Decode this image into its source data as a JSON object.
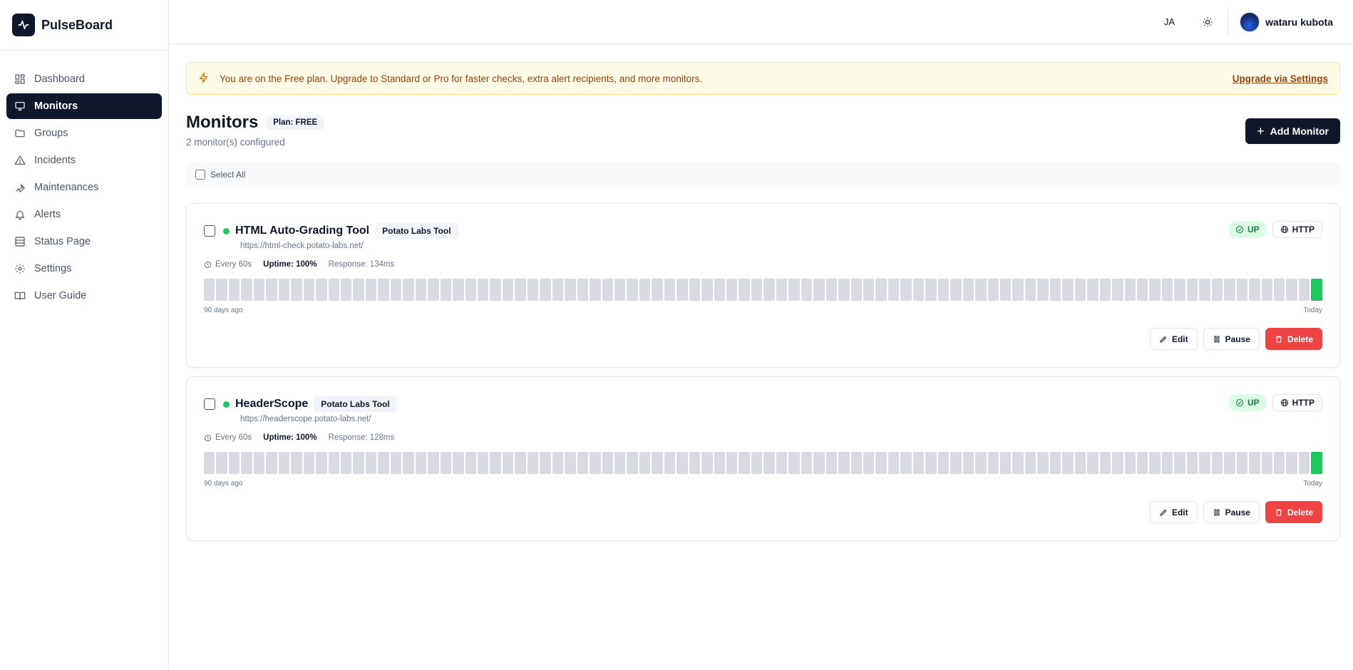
{
  "app": {
    "name": "PulseBoard"
  },
  "sidebar": {
    "items": [
      {
        "label": "Dashboard",
        "icon": "grid-icon",
        "active": false
      },
      {
        "label": "Monitors",
        "icon": "monitor-icon",
        "active": true
      },
      {
        "label": "Groups",
        "icon": "folder-icon",
        "active": false
      },
      {
        "label": "Incidents",
        "icon": "warning-icon",
        "active": false
      },
      {
        "label": "Maintenances",
        "icon": "wrench-icon",
        "active": false
      },
      {
        "label": "Alerts",
        "icon": "bell-icon",
        "active": false
      },
      {
        "label": "Status Page",
        "icon": "layout-icon",
        "active": false
      },
      {
        "label": "Settings",
        "icon": "gear-icon",
        "active": false
      },
      {
        "label": "User Guide",
        "icon": "book-icon",
        "active": false
      }
    ]
  },
  "topbar": {
    "language": "JA",
    "user_name": "wataru kubota"
  },
  "banner": {
    "text": "You are on the Free plan. Upgrade to Standard or Pro for faster checks, extra alert recipients, and more monitors.",
    "link_label": "Upgrade via Settings"
  },
  "page": {
    "title": "Monitors",
    "plan_badge": "Plan: FREE",
    "subtitle": "2 monitor(s) configured",
    "add_button": "Add Monitor",
    "select_all": "Select All"
  },
  "monitors": [
    {
      "name": "HTML Auto-Grading Tool",
      "group": "Potato Labs Tool",
      "url": "https://html-check.potato-labs.net/",
      "status": "UP",
      "type": "HTTP",
      "interval": "Every 60s",
      "uptime": "Uptime: 100%",
      "response": "Response: 134ms",
      "bar_start_label": "90 days ago",
      "bar_end_label": "Today",
      "history_total": 90,
      "history_up_days": 1,
      "edit": "Edit",
      "pause": "Pause",
      "delete": "Delete"
    },
    {
      "name": "HeaderScope",
      "group": "Potato Labs Tool",
      "url": "https://headerscope.potato-labs.net/",
      "status": "UP",
      "type": "HTTP",
      "interval": "Every 60s",
      "uptime": "Uptime: 100%",
      "response": "Response: 128ms",
      "bar_start_label": "90 days ago",
      "bar_end_label": "Today",
      "history_total": 90,
      "history_up_days": 1,
      "edit": "Edit",
      "pause": "Pause",
      "delete": "Delete"
    }
  ],
  "colors": {
    "primary": "#0f172a",
    "up": "#22c55e",
    "danger": "#ef4444",
    "banner_bg": "#fefce8",
    "banner_text": "#92400e"
  }
}
